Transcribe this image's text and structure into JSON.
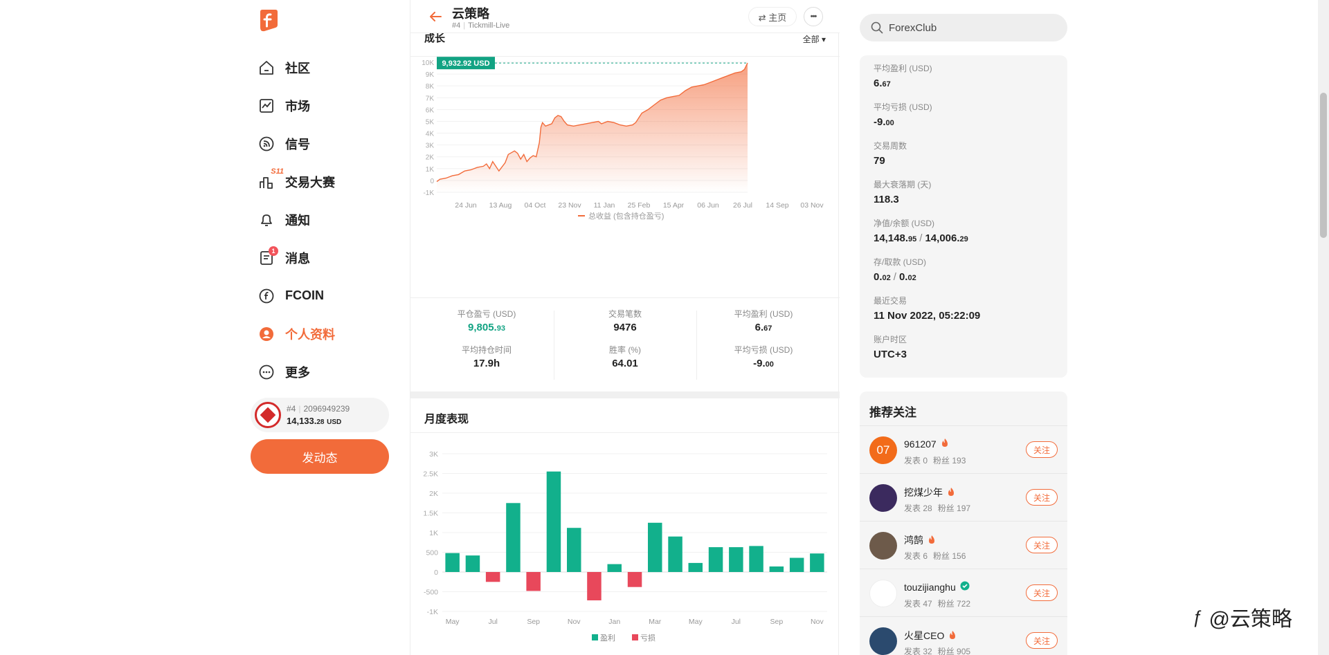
{
  "nav": {
    "items": [
      {
        "label": "社区",
        "icon": "home-icon"
      },
      {
        "label": "市场",
        "icon": "market-chart-icon"
      },
      {
        "label": "信号",
        "icon": "signal-icon"
      },
      {
        "label": "交易大赛",
        "icon": "contest-icon",
        "badge": "S11"
      },
      {
        "label": "通知",
        "icon": "bell-icon"
      },
      {
        "label": "消息",
        "icon": "message-icon",
        "badge": "1"
      },
      {
        "label": "FCOIN",
        "icon": "fcoin-icon"
      },
      {
        "label": "个人资料",
        "icon": "profile-icon"
      },
      {
        "label": "更多",
        "icon": "more-icon"
      }
    ],
    "account": {
      "rank": "#4",
      "id": "2096949239",
      "balance_main": "14,133.",
      "balance_dec": "28",
      "currency": "USD"
    },
    "post_label": "发动态"
  },
  "header": {
    "title": "云策略",
    "rank": "#4",
    "broker": "Tickmill-Live",
    "home_label": "⇄ 主页",
    "more_label": "•••"
  },
  "growth": {
    "title": "成长",
    "range": "全部 ▾",
    "legend": "总收益 (包含持仓盈亏)",
    "current_tag": "9,932.92 USD"
  },
  "chart_data": [
    {
      "type": "area",
      "title": "成长",
      "series": [
        {
          "name": "总收益 (包含持仓盈亏)",
          "color": "#f26b3a"
        }
      ],
      "x_ticks": [
        "24 Jun",
        "13 Aug",
        "04 Oct",
        "23 Nov",
        "11 Jan",
        "25 Feb",
        "15 Apr",
        "06 Jun",
        "26 Jul",
        "14 Sep",
        "03 Nov"
      ],
      "y_ticks": [
        "10K",
        "9K",
        "8K",
        "7K",
        "6K",
        "5K",
        "4K",
        "3K",
        "2K",
        "1K",
        "0",
        "-1K"
      ],
      "ylim": [
        -1000,
        10000
      ],
      "points": [
        [
          0,
          -100
        ],
        [
          0.01,
          100
        ],
        [
          0.03,
          200
        ],
        [
          0.05,
          400
        ],
        [
          0.07,
          500
        ],
        [
          0.09,
          800
        ],
        [
          0.11,
          900
        ],
        [
          0.13,
          1100
        ],
        [
          0.15,
          1200
        ],
        [
          0.16,
          1400
        ],
        [
          0.17,
          1000
        ],
        [
          0.18,
          1600
        ],
        [
          0.2,
          800
        ],
        [
          0.22,
          1500
        ],
        [
          0.23,
          2200
        ],
        [
          0.25,
          2500
        ],
        [
          0.26,
          2300
        ],
        [
          0.27,
          1800
        ],
        [
          0.28,
          2200
        ],
        [
          0.29,
          1600
        ],
        [
          0.3,
          1900
        ],
        [
          0.31,
          2100
        ],
        [
          0.32,
          2000
        ],
        [
          0.33,
          3200
        ],
        [
          0.335,
          4500
        ],
        [
          0.34,
          4900
        ],
        [
          0.35,
          4600
        ],
        [
          0.37,
          4800
        ],
        [
          0.38,
          5300
        ],
        [
          0.39,
          5500
        ],
        [
          0.4,
          5400
        ],
        [
          0.41,
          5000
        ],
        [
          0.42,
          4700
        ],
        [
          0.44,
          4600
        ],
        [
          0.46,
          4700
        ],
        [
          0.48,
          4800
        ],
        [
          0.5,
          4900
        ],
        [
          0.52,
          5000
        ],
        [
          0.53,
          4800
        ],
        [
          0.55,
          5000
        ],
        [
          0.57,
          4900
        ],
        [
          0.59,
          4700
        ],
        [
          0.61,
          4600
        ],
        [
          0.63,
          4700
        ],
        [
          0.64,
          4900
        ],
        [
          0.65,
          5300
        ],
        [
          0.66,
          5700
        ],
        [
          0.68,
          6000
        ],
        [
          0.7,
          6400
        ],
        [
          0.72,
          6800
        ],
        [
          0.74,
          7000
        ],
        [
          0.76,
          7100
        ],
        [
          0.78,
          7200
        ],
        [
          0.8,
          7600
        ],
        [
          0.82,
          7900
        ],
        [
          0.84,
          8000
        ],
        [
          0.86,
          8100
        ],
        [
          0.88,
          8300
        ],
        [
          0.9,
          8500
        ],
        [
          0.92,
          8700
        ],
        [
          0.94,
          8900
        ],
        [
          0.96,
          9100
        ],
        [
          0.98,
          9200
        ],
        [
          0.99,
          9400
        ],
        [
          1.0,
          9933
        ]
      ],
      "current_value": 9932.92
    },
    {
      "type": "bar",
      "title": "月度表现",
      "categories": [
        "May",
        "Jun",
        "Jul",
        "Aug",
        "Sep",
        "Oct",
        "Nov",
        "Dec",
        "Jan",
        "Feb",
        "Mar",
        "Apr",
        "May",
        "Jun",
        "Jul",
        "Aug",
        "Sep",
        "Oct",
        "Nov"
      ],
      "x_tick_labels": [
        "May",
        "Jul",
        "Sep",
        "Nov",
        "Jan",
        "Mar",
        "May",
        "Jul",
        "Sep",
        "Nov"
      ],
      "values": [
        480,
        420,
        -250,
        1750,
        -480,
        2550,
        1120,
        -720,
        200,
        -380,
        1250,
        900,
        230,
        630,
        630,
        660,
        140,
        360,
        470
      ],
      "y_ticks": [
        "3K",
        "2.5K",
        "2K",
        "1.5K",
        "1K",
        "500",
        "0",
        "-500",
        "-1K"
      ],
      "ylim": [
        -1000,
        3000
      ],
      "legend": [
        {
          "name": "盈利",
          "color": "#12b08c"
        },
        {
          "name": "亏损",
          "color": "#e8485b"
        }
      ]
    }
  ],
  "stats": {
    "items": [
      {
        "label": "平仓盈亏 (USD)",
        "main": "9,805.",
        "dec": "93",
        "green": true
      },
      {
        "label": "交易笔数",
        "main": "9476",
        "dec": ""
      },
      {
        "label": "平均盈利 (USD)",
        "main": "6.",
        "dec": "67"
      },
      {
        "label": "平均持仓时间",
        "main": "17.9h",
        "dec": ""
      },
      {
        "label": "胜率 (%)",
        "main": "64.01",
        "dec": ""
      },
      {
        "label": "平均亏损 (USD)",
        "main": "-9.",
        "dec": "00"
      }
    ]
  },
  "monthly": {
    "title": "月度表现"
  },
  "search": {
    "value": "ForexClub"
  },
  "info": {
    "items": [
      {
        "label": "平均盈利 (USD)",
        "main": "6.",
        "dec": "67"
      },
      {
        "label": "平均亏损 (USD)",
        "main": "-9.",
        "dec": "00"
      },
      {
        "label": "交易周数",
        "main": "79",
        "dec": ""
      },
      {
        "label": "最大衰落期 (天)",
        "main": "118.3",
        "dec": ""
      },
      {
        "label": "净值/余额 (USD)",
        "main": "14,148.",
        "dec": "95",
        "main2": "14,006.",
        "dec2": "29"
      },
      {
        "label": "存/取款 (USD)",
        "main": "0.",
        "dec": "02",
        "main2": "0.",
        "dec2": "02"
      },
      {
        "label": "最近交易",
        "main": "11 Nov 2022, 05:22:09",
        "dec": ""
      },
      {
        "label": "账户时区",
        "main": "UTC+3",
        "dec": ""
      }
    ]
  },
  "recommend": {
    "title": "推荐关注",
    "follow_label": "关注",
    "users": [
      {
        "name": "961207",
        "posts": "发表 0",
        "fans": "粉丝 193",
        "avatar_text": "07",
        "avatar_color": "#f26b1a",
        "badge": "fire"
      },
      {
        "name": "挖煤少年",
        "posts": "发表 28",
        "fans": "粉丝 197",
        "avatar_text": "",
        "avatar_color": "#3b2a5e",
        "badge": "fire"
      },
      {
        "name": "鸿鹄",
        "posts": "发表 6",
        "fans": "粉丝 156",
        "avatar_text": "",
        "avatar_color": "#6d5a4a",
        "badge": "fire"
      },
      {
        "name": "touzijianghu",
        "posts": "发表 47",
        "fans": "粉丝 722",
        "avatar_text": "",
        "avatar_color": "#ffffff",
        "badge": "verified"
      },
      {
        "name": "火星CEO",
        "posts": "发表 32",
        "fans": "粉丝 905",
        "avatar_text": "",
        "avatar_color": "#2b4a6e",
        "badge": "fire"
      }
    ]
  },
  "watermark": {
    "text": "@云策略"
  },
  "colors": {
    "accent": "#f26b3a",
    "profit": "#12b08c",
    "loss": "#e8485b",
    "tag": "#12a383"
  }
}
